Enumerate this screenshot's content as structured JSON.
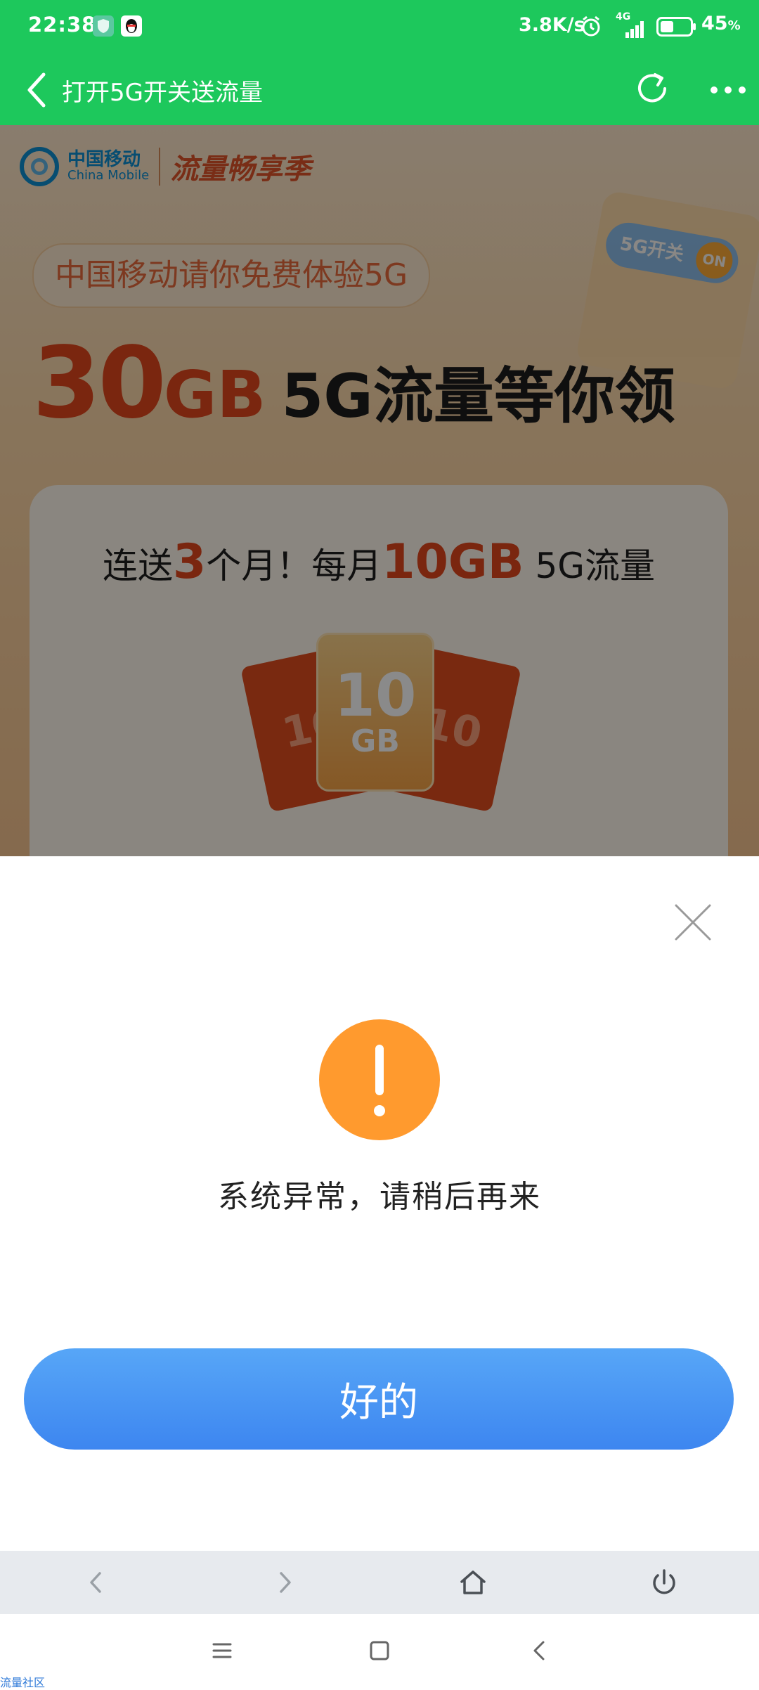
{
  "status_bar": {
    "time": "22:38",
    "net_speed": "3.8K/s",
    "network_type": "4G",
    "battery_percent": "45",
    "battery_unit": "%",
    "battery_level": 0.45
  },
  "title_bar": {
    "title": "打开5G开关送流量"
  },
  "promo": {
    "brand_zh": "中国移动",
    "brand_en": "China Mobile",
    "season_title": "流量畅享季",
    "bubble_text": "中国移动请你免费体验5G",
    "headline_num": "30",
    "headline_unit": "GB",
    "headline_rest": "5G流量等你领",
    "switch_label": "5G开关",
    "switch_state": "ON",
    "line_prefix": "连送",
    "line_months": "3",
    "line_mid": "个月！每月",
    "line_amount": "10GB",
    "line_suffix": " 5G流量",
    "env_left_text": "10",
    "env_right_text": "10",
    "env_value": "10",
    "env_unit": "GB"
  },
  "dialog": {
    "message": "系统异常，请稍后再来",
    "ok_label": "好的"
  },
  "watermark": "流量社区",
  "colors": {
    "title_bar": "#1dc85c",
    "warning": "#ff9a2e",
    "ok_button": "#4596f3",
    "accent_red": "#e2461c"
  },
  "icons": {
    "status": [
      "shield-icon",
      "qq-penguin-icon",
      "alarm-icon",
      "signal-icon",
      "battery-icon"
    ],
    "title_bar": [
      "back-arrow-icon",
      "refresh-icon",
      "more-dots-icon"
    ],
    "dialog": [
      "close-icon",
      "warning-icon"
    ],
    "toolbar": [
      "browser-back-icon",
      "browser-forward-icon",
      "home-icon",
      "power-icon"
    ],
    "nav": [
      "recents-icon",
      "home-square-icon",
      "nav-back-icon"
    ]
  }
}
